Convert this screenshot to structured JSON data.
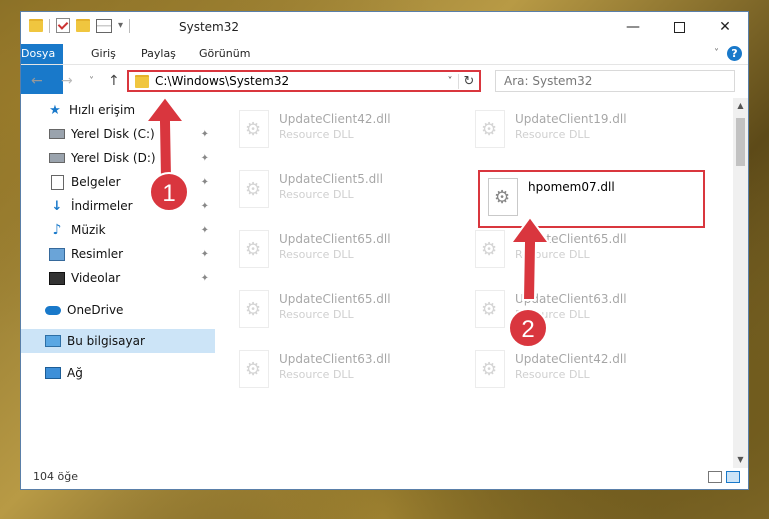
{
  "window": {
    "title": "System32",
    "min_glyph": "—",
    "close_glyph": "✕"
  },
  "ribbon": {
    "tabs": [
      "Dosya",
      "Giriş",
      "Paylaş",
      "Görünüm"
    ],
    "help": "?",
    "expand": "˅"
  },
  "address": {
    "path": "C:\\Windows\\System32",
    "search_placeholder": "Ara: System32",
    "dropdown_glyph": "˅",
    "refresh_glyph": "↻"
  },
  "nav_buttons": {
    "back": "←",
    "forward": "→",
    "recent": "˅",
    "up": "↑"
  },
  "sidebar": {
    "items": [
      {
        "label": "Hızlı erişim",
        "icon": "star-icon",
        "pinned": false
      },
      {
        "label": "Yerel Disk (C:)",
        "icon": "drive-icon",
        "pinned": true
      },
      {
        "label": "Yerel Disk (D:)",
        "icon": "drive-icon",
        "pinned": true
      },
      {
        "label": "Belgeler",
        "icon": "document-icon",
        "pinned": true
      },
      {
        "label": "İndirmeler",
        "icon": "download-icon",
        "pinned": true
      },
      {
        "label": "Müzik",
        "icon": "music-icon",
        "pinned": true
      },
      {
        "label": "Resimler",
        "icon": "pictures-icon",
        "pinned": true
      },
      {
        "label": "Videolar",
        "icon": "videos-icon",
        "pinned": true
      },
      {
        "label": "OneDrive",
        "icon": "onedrive-icon",
        "pinned": false
      },
      {
        "label": "Bu bilgisayar",
        "icon": "this-pc-icon",
        "pinned": false
      },
      {
        "label": "Ağ",
        "icon": "network-icon",
        "pinned": false
      }
    ],
    "pin_glyph": "📌"
  },
  "files": {
    "left": [
      {
        "name": "UpdateClient42.dll",
        "type": "Resource DLL"
      },
      {
        "name": "UpdateClient5.dll",
        "type": "Resource DLL"
      },
      {
        "name": "UpdateClient65.dll",
        "type": "Resource DLL"
      },
      {
        "name": "UpdateClient65.dll",
        "type": "Resource DLL"
      },
      {
        "name": "UpdateClient63.dll",
        "type": "Resource DLL"
      }
    ],
    "right": [
      {
        "name": "UpdateClient19.dll",
        "type": "Resource DLL"
      },
      {
        "name": "hpomem07.dll",
        "type": ""
      },
      {
        "name": "UpdateClient65.dll",
        "type": "Resource DLL"
      },
      {
        "name": "UpdateClient63.dll",
        "type": "Resource DLL"
      },
      {
        "name": "UpdateClient42.dll",
        "type": "Resource DLL"
      }
    ]
  },
  "status": {
    "item_count": "104 öğe"
  },
  "annotations": {
    "step1": "1",
    "step2": "2",
    "color": "#d9363e"
  }
}
